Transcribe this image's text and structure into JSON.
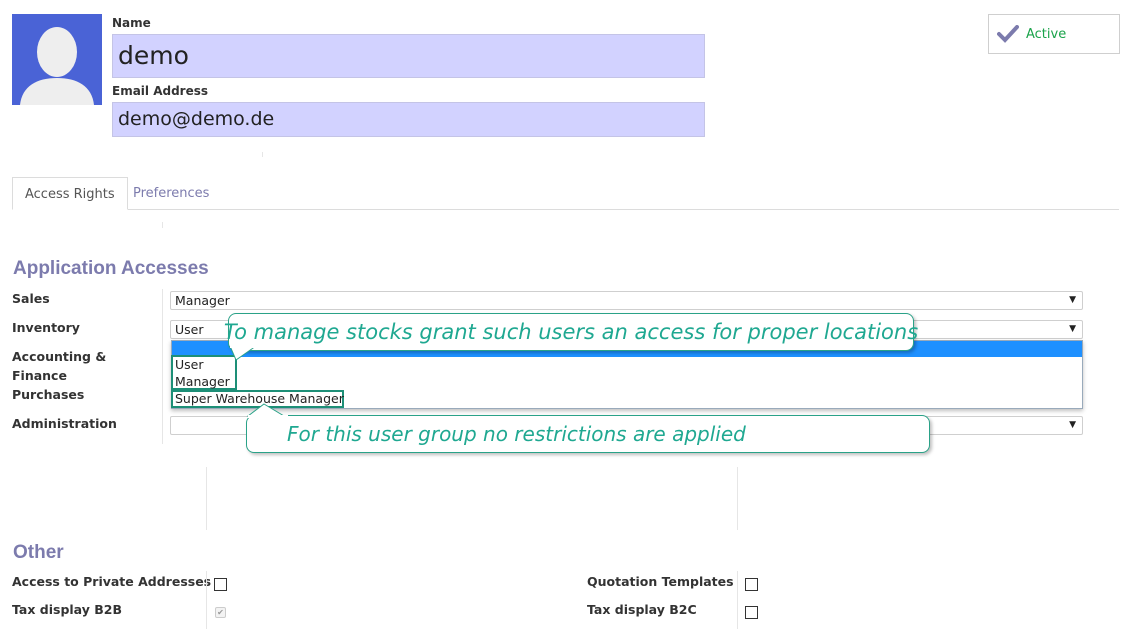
{
  "header": {
    "name_label": "Name",
    "name_value": "demo",
    "email_label": "Email Address",
    "email_value": "demo@demo.de",
    "active_label": "Active"
  },
  "tabs": [
    {
      "label": "Access Rights",
      "active": true
    },
    {
      "label": "Preferences",
      "active": false
    }
  ],
  "application_accesses": {
    "title": "Application Accesses",
    "rows": [
      {
        "label": "Sales",
        "value": "Manager"
      },
      {
        "label": "Inventory",
        "value": "User"
      },
      {
        "label": "Accounting &",
        "label2": "Finance",
        "value": ""
      },
      {
        "label": "Purchases",
        "value": ""
      },
      {
        "label": "Administration",
        "value": ""
      }
    ],
    "dropdown_options": [
      "User",
      "Manager",
      "Super Warehouse Manager"
    ]
  },
  "annotations": {
    "top": "To manage stocks grant such users an access for proper locations",
    "bottom": "For this user group no restrictions are applied"
  },
  "other": {
    "title": "Other",
    "items": [
      {
        "label": "Access to Private Addresses",
        "checked": false
      },
      {
        "label": "Tax display B2B",
        "checked": true,
        "disabled": true
      },
      {
        "label": "Quotation Templates",
        "checked": false
      },
      {
        "label": "Tax display B2C",
        "checked": false
      }
    ]
  },
  "colors": {
    "accent": "#7c7bad",
    "highlight_input": "#d2d2ff",
    "active_green": "#1aa34a",
    "callout_teal": "#1fa891",
    "dropdown_selected": "#1e90ff"
  }
}
